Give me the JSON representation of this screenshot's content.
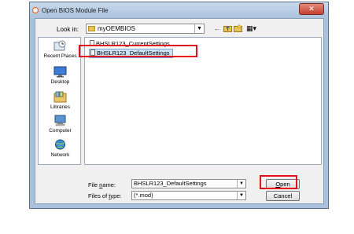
{
  "window": {
    "title": "Open BIOS Module File",
    "close_label": "✕"
  },
  "toolbar": {
    "look_in_label": "Look in:",
    "look_in_value": "myOEMBIOS",
    "icons": [
      "back-icon",
      "up-folder-icon",
      "new-folder-icon",
      "view-menu-icon"
    ],
    "back_glyph": "←",
    "view_glyph": "▦▾"
  },
  "sidebar": {
    "items": [
      {
        "label": "Recent Places",
        "icon": "recent-places-icon"
      },
      {
        "label": "Desktop",
        "icon": "desktop-icon"
      },
      {
        "label": "Libraries",
        "icon": "libraries-icon"
      },
      {
        "label": "Computer",
        "icon": "computer-icon"
      },
      {
        "label": "Network",
        "icon": "network-icon"
      }
    ]
  },
  "files": [
    {
      "name": "BHSLR123_CurrentSettings",
      "selected": false
    },
    {
      "name": "BHSLR123_DefaultSettings",
      "selected": true
    }
  ],
  "bottom": {
    "file_name_label_pre": "File ",
    "file_name_label_key": "n",
    "file_name_label_post": "ame:",
    "file_name_value": "BHSLR123_DefaultSettings",
    "file_type_label_pre": "Files of ",
    "file_type_label_key": "t",
    "file_type_label_post": "ype:",
    "file_type_value": "(*.mod)",
    "open_label_key": "O",
    "open_label_post": "pen",
    "cancel_label": "Cancel"
  },
  "colors": {
    "highlight": "#e0121b",
    "selection": "#cce4f7",
    "frame": "#a9c1dd"
  }
}
